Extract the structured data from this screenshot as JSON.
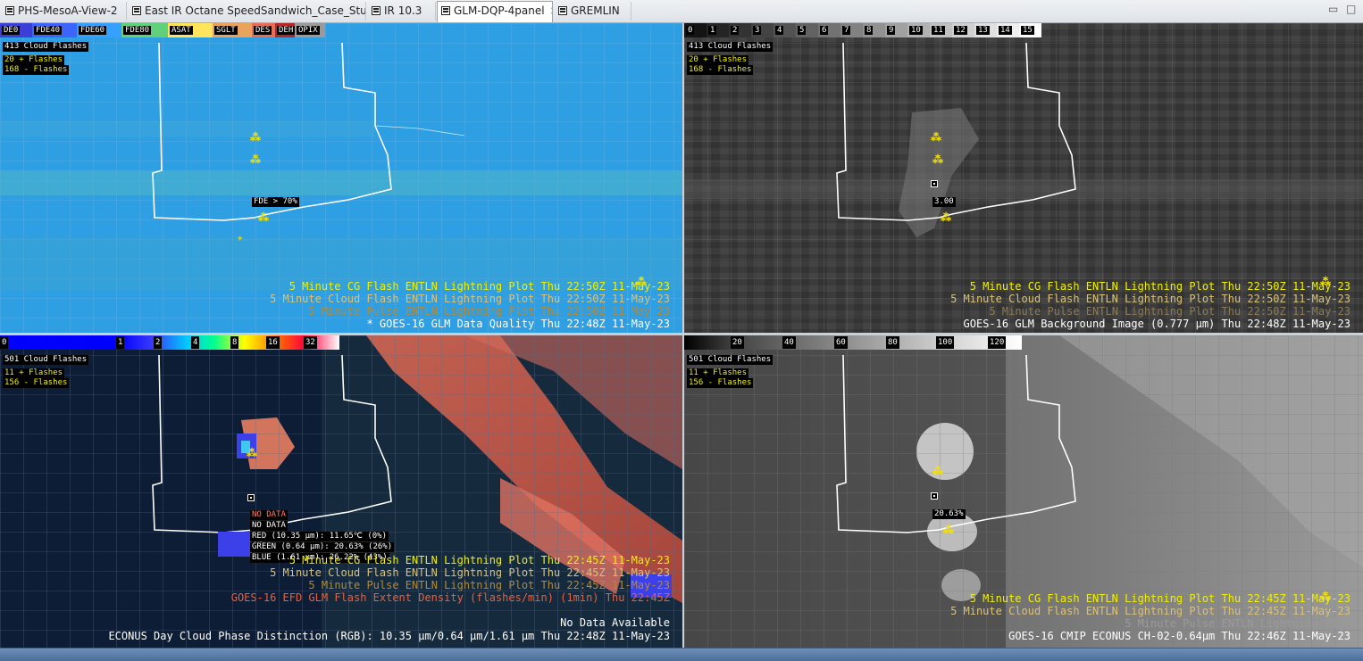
{
  "tabs": [
    {
      "label": "PHS-MesoA-View-2",
      "active": false
    },
    {
      "label": "East IR Octane SpeedSandwich_Case_Study",
      "active": false
    },
    {
      "label": "IR  10.3",
      "active": false
    },
    {
      "label": "GLM-DQP-4panel",
      "active": true,
      "close": "×"
    },
    {
      "label": "GREMLIN",
      "active": false
    }
  ],
  "window_buttons": {
    "minimize": "▭",
    "maximize": "□"
  },
  "panels": {
    "p1": {
      "colorbar": [
        {
          "label": "DE0",
          "color": "#3b3fd6"
        },
        {
          "label": "FDE40",
          "color": "#3c64ff"
        },
        {
          "label": "FDE60",
          "color": "#35a0ff"
        },
        {
          "label": "FDE80",
          "color": "#5fd17a"
        },
        {
          "label": "ASAT",
          "color": "#ffe45c"
        },
        {
          "label": "SGLT",
          "color": "#e8a35c"
        },
        {
          "label": "DES",
          "color": "#e86d55"
        },
        {
          "label": "DEH",
          "color": "#b52828"
        },
        {
          "label": "OPIX",
          "color": "#9a9a9a"
        }
      ],
      "legend": [
        "413 Cloud Flashes",
        "20 + Flashes",
        "168 - Flashes"
      ],
      "readout": "FDE > 70%",
      "annotations": [
        {
          "text": "5 Minute CG Flash ENTLN Lightning Plot   Thu 22:50Z 11-May-23",
          "color": "#f0f000"
        },
        {
          "text": "5 Minute Cloud Flash ENTLN Lightning Plot   Thu 22:50Z 11-May-23",
          "color": "#d8c27a"
        },
        {
          "text": "5 Minute Pulse ENTLN Lightning Plot   Thu 22:50Z 11-May-23",
          "color": "#b08a3a"
        },
        {
          "text": "* GOES-16 GLM Data Quality   Thu 22:48Z 11-May-23",
          "color": "#ffffff"
        }
      ]
    },
    "p2": {
      "colorbar": [
        "0",
        "1",
        "2",
        "3",
        "4",
        "5",
        "6",
        "7",
        "8",
        "9",
        "10",
        "11",
        "12",
        "13",
        "14",
        "15"
      ],
      "legend": [
        "413 Cloud Flashes",
        "20 + Flashes",
        "168 - Flashes"
      ],
      "readout": "3.00",
      "annotations": [
        {
          "text": "5 Minute CG Flash ENTLN Lightning Plot   Thu 22:50Z 11-May-23",
          "color": "#f0f000"
        },
        {
          "text": "5 Minute Cloud Flash ENTLN Lightning Plot   Thu 22:50Z 11-May-23",
          "color": "#d8c27a"
        },
        {
          "text": "5 Minute Pulse ENTLN Lightning Plot   Thu 22:50Z 11-May-23",
          "color": "#8a7a5a"
        },
        {
          "text": "GOES-16 GLM Background Image (0.777 µm)   Thu 22:48Z 11-May-23",
          "color": "#ffffff"
        }
      ]
    },
    "p3": {
      "colorbar": [
        "0",
        "1",
        "2",
        "4",
        "8",
        "16",
        "32"
      ],
      "legend": [
        "501 Cloud Flashes",
        "11 + Flashes",
        "156 - Flashes"
      ],
      "readout": [
        "NO DATA",
        "NO DATA",
        "RED (10.35 µm): 11.65℃ (0%)",
        "GREEN (0.64 µm): 20.63% (26%)",
        "BLUE (1.61 µm): 26.22% (43%)"
      ],
      "annotations": [
        {
          "text": "5 Minute CG Flash ENTLN Lightning Plot   Thu 22:45Z 11-May-23",
          "color": "#f0f000"
        },
        {
          "text": "5 Minute Cloud Flash ENTLN Lightning Plot   Thu 22:45Z 11-May-23",
          "color": "#d8c27a"
        },
        {
          "text": "5 Minute Pulse ENTLN Lightning Plot   Thu 22:45Z 11-May-23",
          "color": "#b08a3a"
        },
        {
          "text": "GOES-16 EFD GLM Flash Extent Density (flashes/min) (1min)   Thu 22:45Z",
          "color": "#e8603c"
        },
        {
          "text": "No Data Available",
          "color": "#ffffff"
        },
        {
          "text": "ECONUS Day Cloud Phase Distinction (RGB): 10.35 µm/0.64 µm/1.61 µm Thu 22:48Z 11-May-23",
          "color": "#ffffff"
        }
      ]
    },
    "p4": {
      "colorbar": [
        "20",
        "40",
        "60",
        "80",
        "100",
        "120"
      ],
      "legend": [
        "501 Cloud Flashes",
        "11 + Flashes",
        "156 - Flashes"
      ],
      "readout": "20.63%",
      "annotations": [
        {
          "text": "5 Minute CG Flash ENTLN Lightning Plot   Thu 22:45Z 11-May-23",
          "color": "#f0f000"
        },
        {
          "text": "5 Minute Cloud Flash ENTLN Lightning Plot   Thu 22:45Z 11-May-23",
          "color": "#d8c27a"
        },
        {
          "text": "5 Minute Pulse ENTLN Lightning Plot",
          "color": "#9a9a9a"
        },
        {
          "text": "GOES-16 CMIP ECONUS CH-02-0.64µm   Thu 22:46Z 11-May-23",
          "color": "#ffffff"
        }
      ]
    }
  }
}
